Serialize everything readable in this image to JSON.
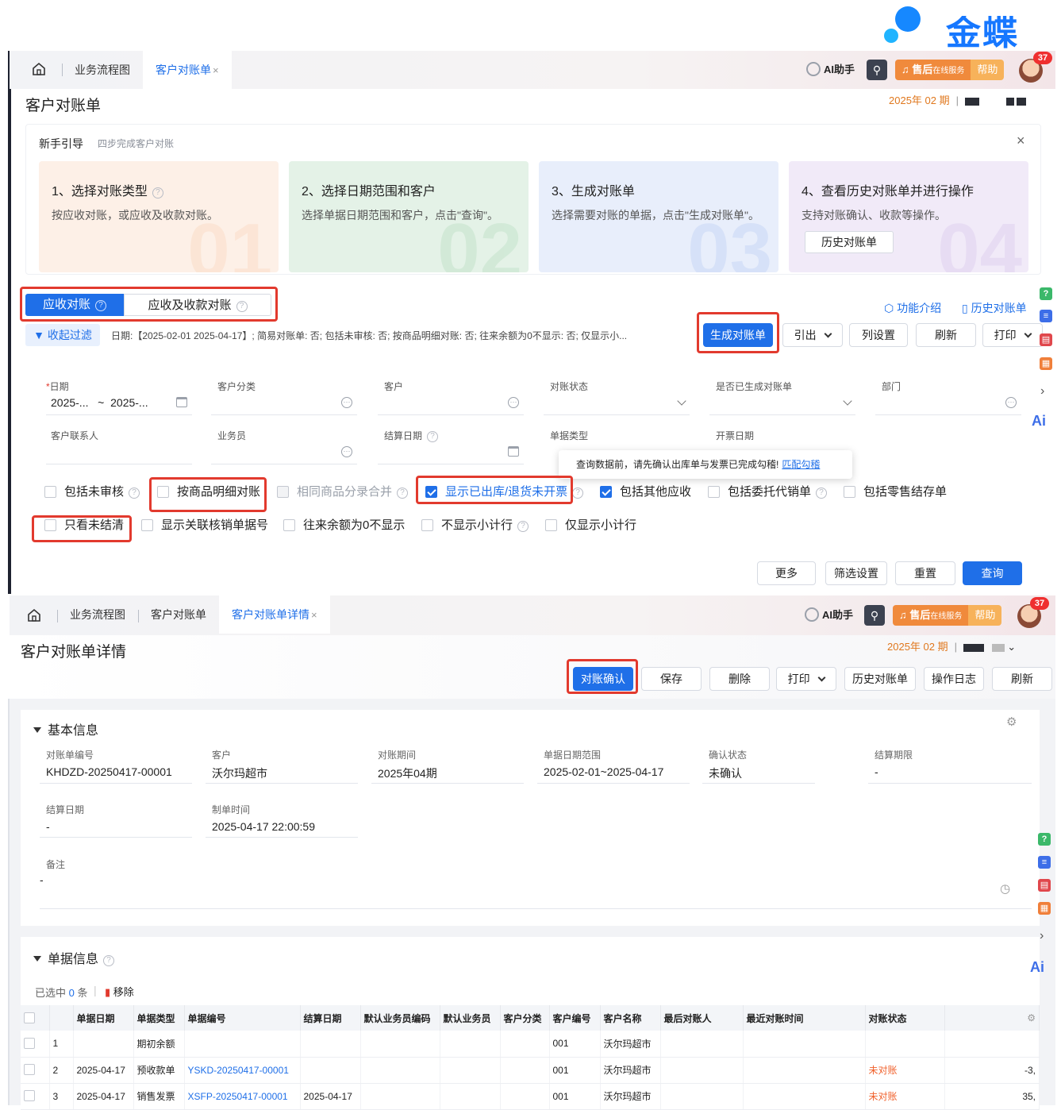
{
  "logo": {
    "text": "金蝶"
  },
  "screen1": {
    "tabs": [
      "业务流程图",
      "客户对账单"
    ],
    "active_tab_index": 1,
    "ai_assistant": "AI助手",
    "service": {
      "label": "售后",
      "sub": "在线服务",
      "help": "帮助"
    },
    "notif_count": "37",
    "page_title": "客户对账单",
    "period": "2025年 02 期",
    "guide": {
      "title": "新手引导",
      "subtitle": "四步完成客户对账",
      "steps": [
        {
          "title": "1、选择对账类型",
          "desc": "按应收对账，或应收及收款对账。",
          "num": "01",
          "color": "#fdf0e7",
          "accent": "#f39b5a"
        },
        {
          "title": "2、选择日期范围和客户",
          "desc": "选择单据日期范围和客户，点击\"查询\"。",
          "num": "02",
          "color": "#e7f3ea",
          "accent": "#57b06d"
        },
        {
          "title": "3、生成对账单",
          "desc": "选择需要对账的单据，点击\"生成对账单\"。",
          "num": "03",
          "color": "#e8eefb",
          "accent": "#5b86e5"
        },
        {
          "title": "4、查看历史对账单并进行操作",
          "desc": "支持对账确认、收款等操作。",
          "num": "04",
          "color": "#f1eaf8",
          "accent": "#a57ad6",
          "button": "历史对账单"
        }
      ]
    },
    "segment": {
      "options": [
        "应收对账",
        "应收及收款对账"
      ],
      "active": 0
    },
    "links": {
      "feature_intro": "功能介绍",
      "history": "历史对账单"
    },
    "filter": {
      "toggle": "收起过滤",
      "summary": "日期:【2025-02-01 2025-04-17】; 简易对账单: 否; 包括未审核: 否; 按商品明细对账: 否; 往来余额为0不显示: 否; 仅显示小..."
    },
    "toolbar": {
      "generate": "生成对账单",
      "import": "引出",
      "columns": "列设置",
      "refresh": "刷新",
      "print": "打印"
    },
    "fields_row1": [
      {
        "label": "日期",
        "required": true,
        "value_from": "2025-...",
        "tilde": "~",
        "value_to": "2025-..."
      },
      {
        "label": "客户分类"
      },
      {
        "label": "客户"
      },
      {
        "label": "对账状态"
      },
      {
        "label": "是否已生成对账单"
      },
      {
        "label": "部门"
      }
    ],
    "fields_row2": [
      {
        "label": "客户联系人"
      },
      {
        "label": "业务员"
      },
      {
        "label": "结算日期"
      },
      {
        "label": "单据类型"
      },
      {
        "label": "开票日期"
      }
    ],
    "tooltip": {
      "text": "查询数据前，请先确认出库单与发票已完成勾稽!",
      "link": "匹配勾稽"
    },
    "checkboxes_row1": [
      {
        "label": "包括未审核",
        "checked": false,
        "help": true
      },
      {
        "label": "按商品明细对账",
        "checked": false
      },
      {
        "label": "相同商品分录合并",
        "checked": false,
        "help": true,
        "disabled": true
      },
      {
        "label": "显示已出库/退货未开票",
        "checked": true,
        "help": true,
        "blue": true
      },
      {
        "label": "包括其他应收",
        "checked": true
      },
      {
        "label": "包括委托代销单",
        "checked": false,
        "help": true
      },
      {
        "label": "包括零售结存单",
        "checked": false
      }
    ],
    "checkboxes_row2": [
      {
        "label": "只看未结清",
        "checked": false
      },
      {
        "label": "显示关联核销单据号",
        "checked": false
      },
      {
        "label": "往来余额为0不显示",
        "checked": false
      },
      {
        "label": "不显示小计行",
        "checked": false,
        "help": true
      },
      {
        "label": "仅显示小计行",
        "checked": false
      }
    ],
    "bottom_buttons": {
      "more": "更多",
      "filter_settings": "筛选设置",
      "reset": "重置",
      "query": "查询"
    }
  },
  "screen2": {
    "tabs": [
      "业务流程图",
      "客户对账单",
      "客户对账单详情"
    ],
    "active_tab_index": 2,
    "ai_assistant": "AI助手",
    "service": {
      "label": "售后",
      "sub": "在线服务",
      "help": "帮助"
    },
    "notif_count": "37",
    "page_title": "客户对账单详情",
    "period": "2025年 02 期",
    "toolbar": {
      "confirm": "对账确认",
      "save": "保存",
      "delete": "删除",
      "print": "打印",
      "history": "历史对账单",
      "log": "操作日志",
      "refresh": "刷新"
    },
    "basic": {
      "title": "基本信息",
      "fields": [
        {
          "label": "对账单编号",
          "value": "KHDZD-20250417-00001"
        },
        {
          "label": "客户",
          "value": "沃尔玛超市"
        },
        {
          "label": "对账期间",
          "value": "2025年04期"
        },
        {
          "label": "单据日期范围",
          "value": "2025-02-01~2025-04-17"
        },
        {
          "label": "确认状态",
          "value": "未确认"
        },
        {
          "label": "结算期限",
          "value": "-"
        },
        {
          "label": "结算日期",
          "value": "-"
        },
        {
          "label": "制单时间",
          "value": "2025-04-17 22:00:59"
        }
      ],
      "remark_label": "备注",
      "remark_value": "-"
    },
    "docs": {
      "title": "单据信息",
      "selected_prefix": "已选中",
      "selected_count": "0",
      "selected_unit": "条",
      "remove": "移除",
      "columns": [
        "单据日期",
        "单据类型",
        "单据编号",
        "结算日期",
        "默认业务员编码",
        "默认业务员",
        "客户分类",
        "客户编号",
        "客户名称",
        "最后对账人",
        "最近对账时间",
        "对账状态"
      ],
      "rows": [
        {
          "idx": "1",
          "date": "",
          "type": "期初余额",
          "no": "",
          "settle": "",
          "cust_no": "001",
          "cust": "沃尔玛超市",
          "status": "",
          "amount": ""
        },
        {
          "idx": "2",
          "date": "2025-04-17",
          "type": "预收款单",
          "no": "YSKD-20250417-00001",
          "settle": "",
          "cust_no": "001",
          "cust": "沃尔玛超市",
          "status": "未对账",
          "amount": "-3,"
        },
        {
          "idx": "3",
          "date": "2025-04-17",
          "type": "销售发票",
          "no": "XSFP-20250417-00001",
          "settle": "2025-04-17",
          "cust_no": "001",
          "cust": "沃尔玛超市",
          "status": "未对账",
          "amount": "35,"
        }
      ]
    }
  },
  "colors": {
    "accent": "#1f6fe8",
    "highlight": "#e23a2e",
    "status_unreconciled": "#f0612c",
    "period": "#e0781e"
  }
}
